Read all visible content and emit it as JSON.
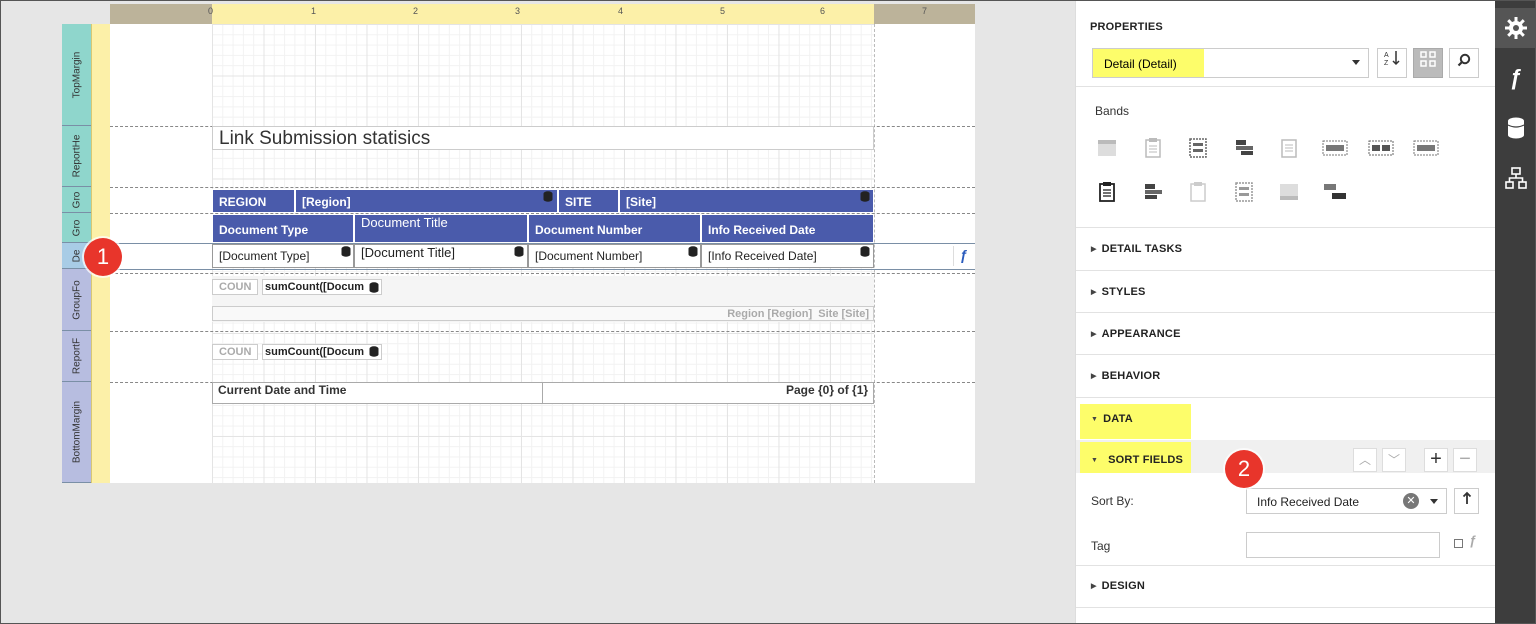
{
  "ruler": {
    "ticks": [
      "0",
      "1",
      "2",
      "3",
      "4",
      "5",
      "6",
      "7"
    ]
  },
  "bands": [
    {
      "label": "TopMargin",
      "color": "#8fd6cc"
    },
    {
      "label": "ReportHe",
      "color": "#8fd6cc"
    },
    {
      "label": "Gro",
      "color": "#8fd6cc"
    },
    {
      "label": "Gro",
      "color": "#8fd6cc"
    },
    {
      "label": "De",
      "color": "#a8cce6"
    },
    {
      "label": "GroupFo",
      "color": "#b7bde0"
    },
    {
      "label": "ReportF",
      "color": "#b7bde0"
    },
    {
      "label": "BottomMargin",
      "color": "#b7bde0"
    }
  ],
  "report": {
    "title": "Link Submission statisics",
    "group_header1": {
      "region_label": "REGION",
      "region_field": "[Region]",
      "site_label": "SITE",
      "site_field": "[Site]"
    },
    "column_headers": [
      "Document Type",
      "Document Title",
      "Document Number",
      "Info Received Date"
    ],
    "detail_fields": [
      "[Document Type]",
      "[Document Title]",
      "[Document Number]",
      "[Info Received Date]"
    ],
    "group_footer": {
      "count_label": "COUN",
      "sum_expr": "sumCount([Docum",
      "region_summary": "Region [Region]  Site [Site]"
    },
    "report_footer": {
      "count_label": "COUN",
      "sum_expr": "sumCount([Docum"
    },
    "bottom_margin": {
      "left": "Current Date and Time",
      "right": "Page {0} of {1}"
    }
  },
  "callouts": {
    "one": "1",
    "two": "2"
  },
  "panel": {
    "title": "PROPERTIES",
    "selected": "Detail (Detail)",
    "bands_label": "Bands",
    "sections": {
      "detail_tasks": "DETAIL TASKS",
      "styles": "STYLES",
      "appearance": "APPEARANCE",
      "behavior": "BEHAVIOR",
      "data": "DATA",
      "sort_fields": "SORT FIELDS",
      "design": "DESIGN"
    },
    "sort_by_label": "Sort By:",
    "sort_by_value": "Info Received Date",
    "tag_label": "Tag",
    "tag_value": ""
  },
  "colors": {
    "band_header_blue": "#4a5bab",
    "highlight_yellow": "#fdfd6a",
    "callout_red": "#e8352b",
    "sidebar_bg": "#3d3d3d"
  },
  "sidebar": [
    "gear-icon",
    "function-icon",
    "database-icon",
    "hierarchy-icon"
  ]
}
